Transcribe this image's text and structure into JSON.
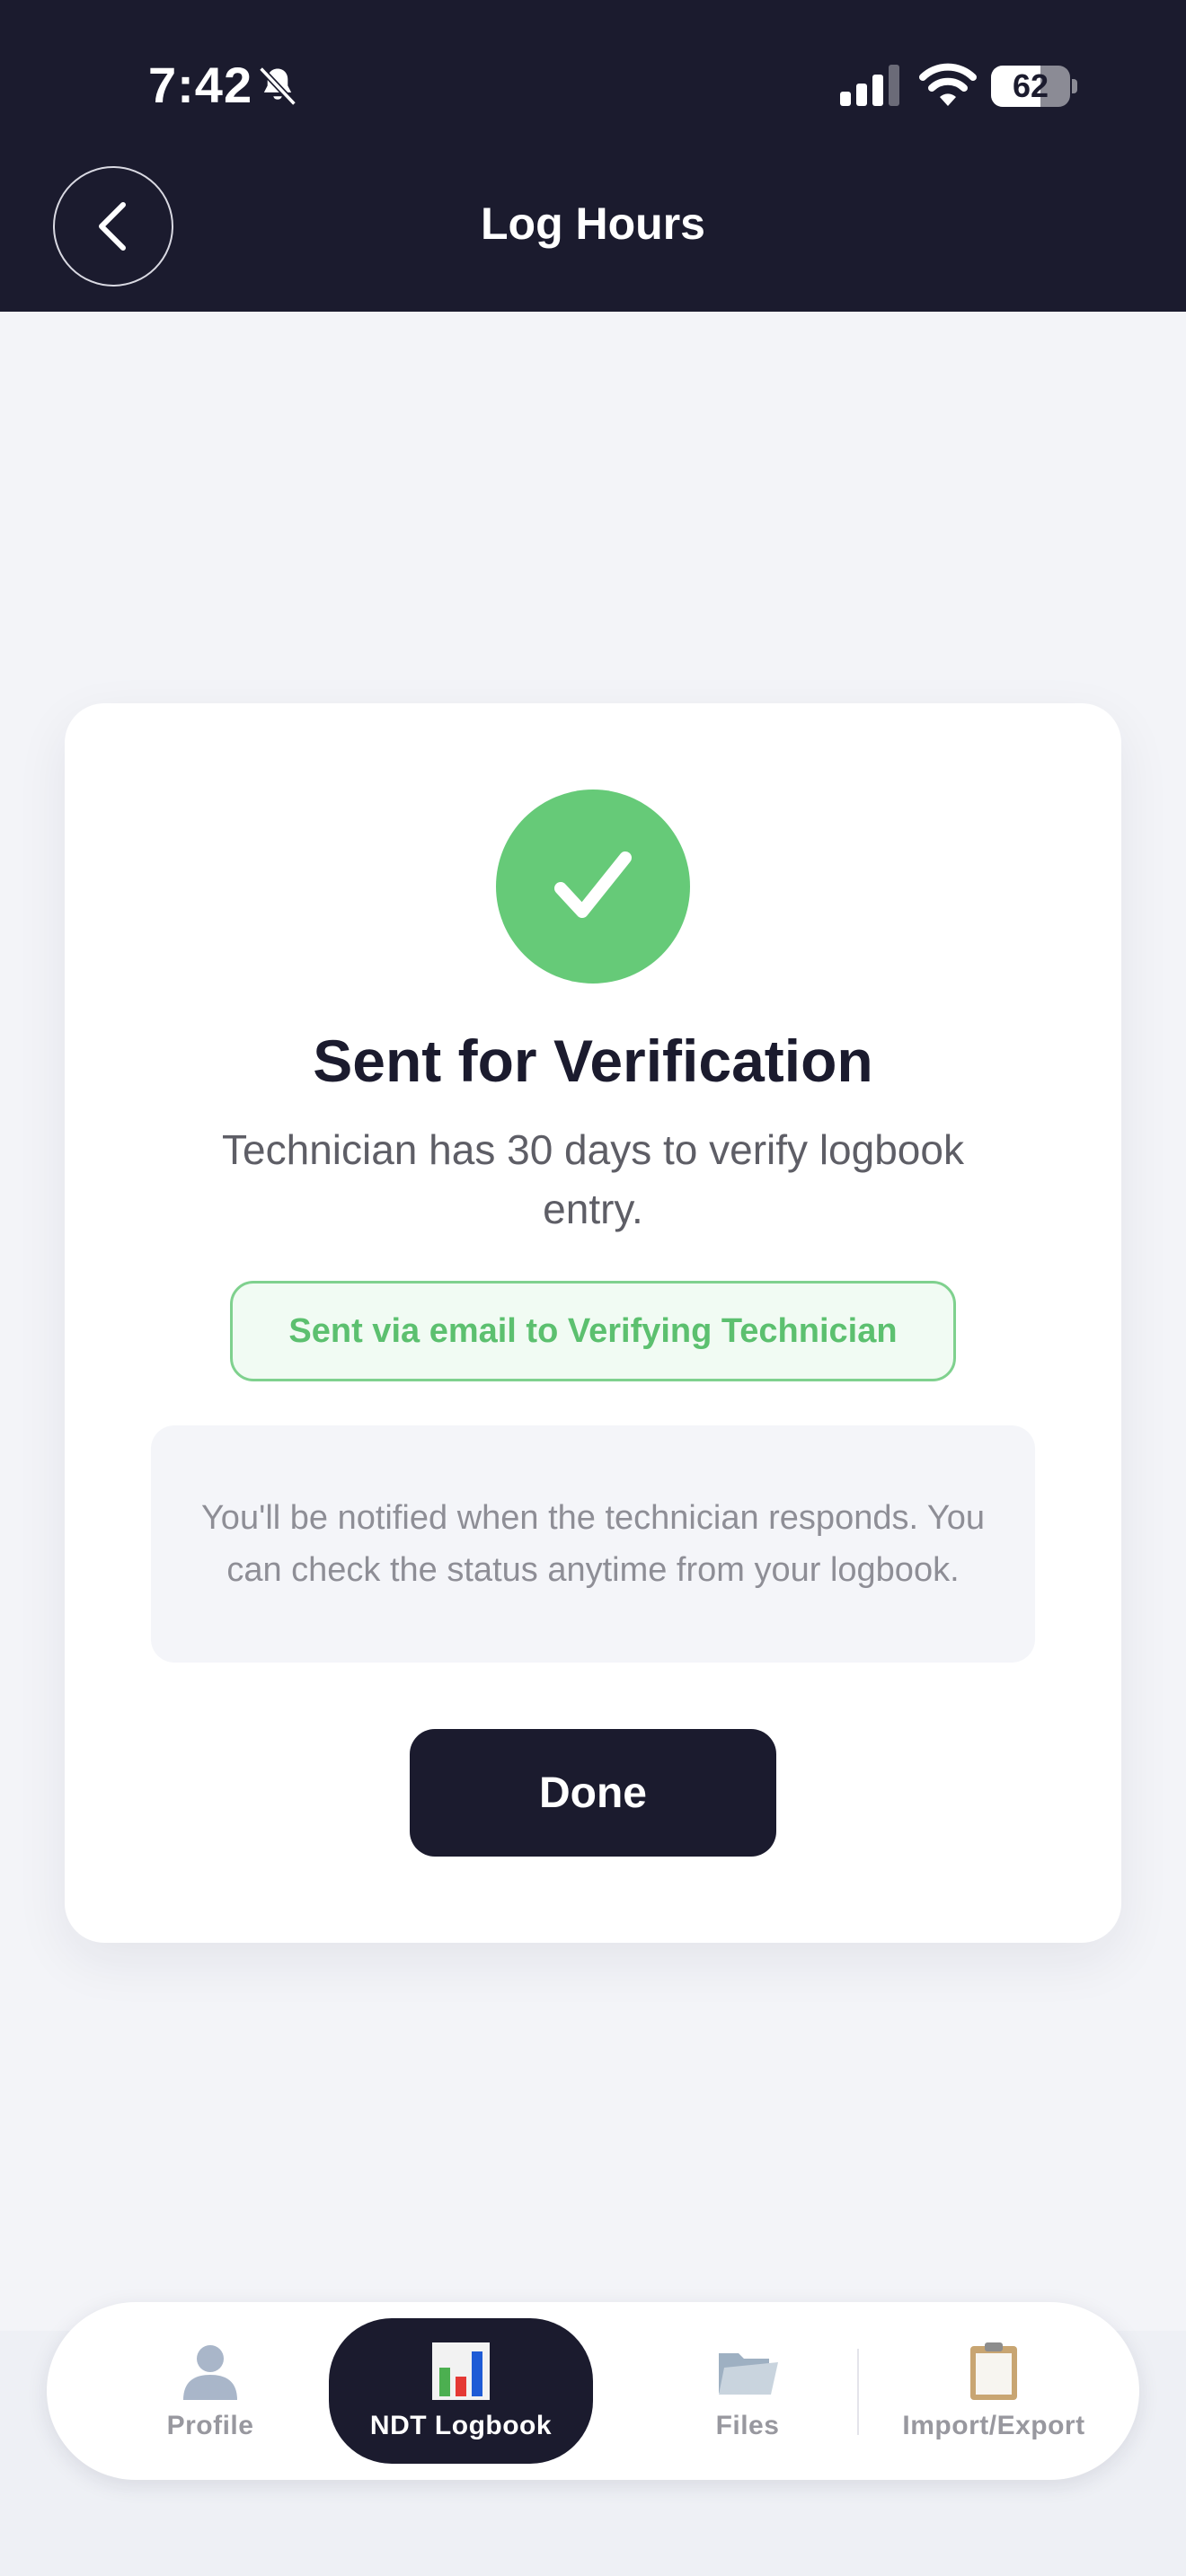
{
  "status_bar": {
    "time": "7:42",
    "battery_percent": "62",
    "battery_level": 0.62
  },
  "header": {
    "title": "Log Hours"
  },
  "card": {
    "title": "Sent for Verification",
    "description": "Technician has 30 days to verify logbook entry.",
    "email_badge": "Sent via email to Verifying Technician",
    "info": "You'll be notified when the technician responds. You can check the status anytime from your logbook.",
    "done_label": "Done"
  },
  "tabs": [
    {
      "label": "Profile",
      "icon": "person-icon",
      "active": false
    },
    {
      "label": "NDT Logbook",
      "icon": "bar-chart-icon",
      "active": true
    },
    {
      "label": "Files",
      "icon": "folder-icon",
      "active": false
    },
    {
      "label": "Import/Export",
      "icon": "clipboard-icon",
      "active": false
    }
  ],
  "colors": {
    "header_bg": "#1b1b2e",
    "success_green": "#66ca78",
    "page_bg": "#f3f4f8"
  }
}
